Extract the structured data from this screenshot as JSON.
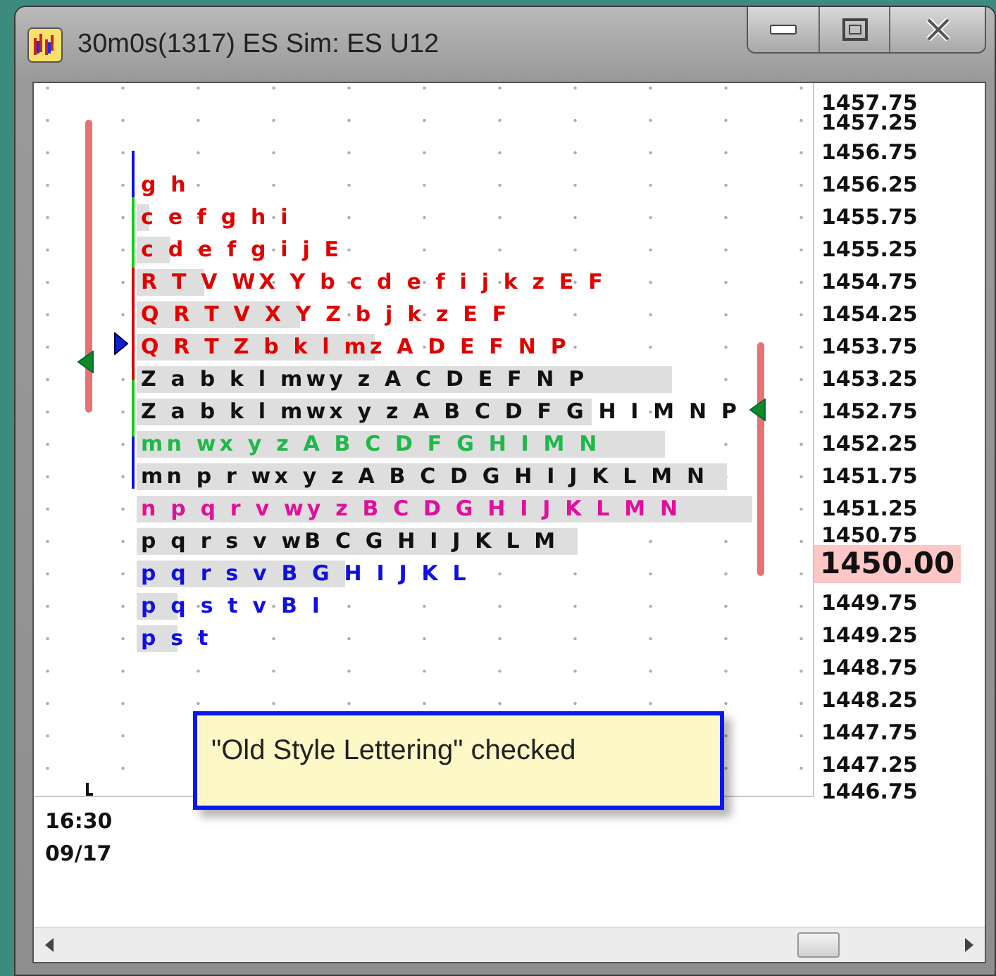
{
  "window": {
    "title": "30m0s(1317) ES Sim: ES U12"
  },
  "profile_rows": [
    {
      "letters": "g h",
      "color": "#e00000"
    },
    {
      "letters": "c e f g h i",
      "color": "#e00000"
    },
    {
      "letters": "c d e f g i j E",
      "color": "#e00000"
    },
    {
      "letters": "R T V WX Y b c d e f i j k z E F",
      "color": "#e00000"
    },
    {
      "letters": "Q R T V X Y Z b j k z E F",
      "color": "#e00000"
    },
    {
      "letters": "Q R T Z b k l mz A D E F N P",
      "color": "#e00000"
    },
    {
      "letters": "Z a b k l mwy z A C D E F N P",
      "color": "#111111"
    },
    {
      "letters": "Z a b k l mwx y z A B C D F G H I M N P",
      "color": "#111111"
    },
    {
      "letters": "mn wx y z A B C D F G H I M N",
      "color": "#1fb84a"
    },
    {
      "letters": "mn p r wx y z A B C D G H I J K L M N",
      "color": "#111111"
    },
    {
      "letters": "n p q r v wy z B C D G H I J K L M N",
      "color": "#e0109a"
    },
    {
      "letters": "p q r s v wB C G H I J K L M",
      "color": "#111111"
    },
    {
      "letters": "p q r s v B G H I J K L",
      "color": "#1010e0"
    },
    {
      "letters": "p q s t v B I",
      "color": "#1010e0"
    },
    {
      "letters": "p s t",
      "color": "#1010e0"
    }
  ],
  "price_axis": [
    {
      "label": "1457.75",
      "kind": "squeezed"
    },
    {
      "label": "1457.25",
      "kind": "squeezed"
    },
    {
      "label": "1456.75",
      "kind": "normal"
    },
    {
      "label": "1456.25",
      "kind": "normal"
    },
    {
      "label": "1455.75",
      "kind": "normal"
    },
    {
      "label": "1455.25",
      "kind": "normal"
    },
    {
      "label": "1454.75",
      "kind": "normal"
    },
    {
      "label": "1454.25",
      "kind": "normal"
    },
    {
      "label": "1453.75",
      "kind": "normal"
    },
    {
      "label": "1453.25",
      "kind": "normal"
    },
    {
      "label": "1452.75",
      "kind": "normal"
    },
    {
      "label": "1452.25",
      "kind": "normal"
    },
    {
      "label": "1451.75",
      "kind": "normal"
    },
    {
      "label": "1451.25",
      "kind": "normal"
    },
    {
      "label": "1450.75",
      "kind": "squeezed"
    },
    {
      "label": "1450.00",
      "kind": "current"
    },
    {
      "label": "1449.75",
      "kind": "normal"
    },
    {
      "label": "1449.25",
      "kind": "normal"
    },
    {
      "label": "1448.75",
      "kind": "normal"
    },
    {
      "label": "1448.25",
      "kind": "normal"
    },
    {
      "label": "1447.75",
      "kind": "normal"
    },
    {
      "label": "1447.25",
      "kind": "normal"
    },
    {
      "label": "1446.75",
      "kind": "squeezed"
    }
  ],
  "time_axis": {
    "time": "16:30",
    "date": "09/17"
  },
  "tooltip": {
    "text": "\"Old Style Lettering\" checked"
  }
}
